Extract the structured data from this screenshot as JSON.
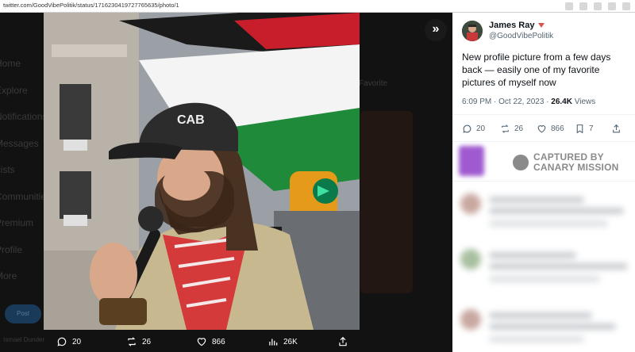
{
  "browser": {
    "url": "twitter.com/GoodVibePolitik/status/1716230419727765635/photo/1"
  },
  "backdrop": {
    "nav_items": [
      "Home",
      "Explore",
      "Notifications",
      "Messages",
      "Lists",
      "Communities",
      "Premium",
      "Profile",
      "More"
    ],
    "post_label": "Post",
    "user_label": "Ismael Dunder",
    "right_label": "Favorite"
  },
  "photo": {
    "cap_text": "CAB"
  },
  "media_actions": {
    "replies": "20",
    "retweets": "26",
    "likes": "866",
    "views": "26K"
  },
  "tweet": {
    "author_name": "James Ray",
    "author_handle": "@GoodVibePolitik",
    "text": "New profile picture from a few days back — easily one of my favorite pictures of myself now",
    "time": "6:09 PM · Oct 22, 2023 · ",
    "views_count": "26.4K",
    "views_label": " Views",
    "replies": "20",
    "retweets": "26",
    "likes": "866",
    "bookmarks": "7"
  },
  "watermark": {
    "line1": "CAPTURED BY",
    "line2": "CANARY MISSION"
  },
  "colors": {
    "flag_red": "#c81e2c",
    "flag_green": "#1f8a3a",
    "keffiyeh_red": "#d43a3a",
    "jacket": "#c8b890",
    "canary_gray": "#8a8a8a"
  }
}
